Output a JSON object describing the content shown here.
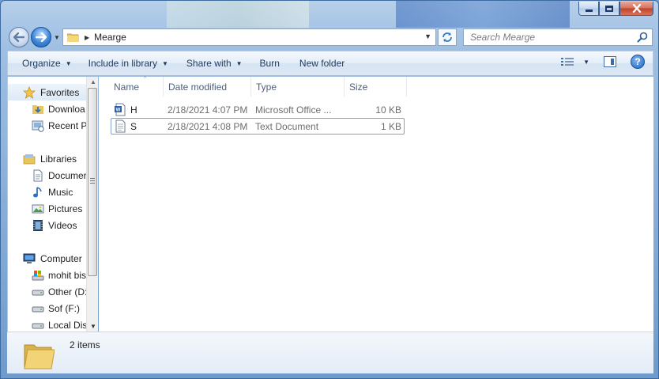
{
  "window": {
    "address": {
      "crumb": "Mearge"
    },
    "search": {
      "placeholder": "Search Mearge"
    }
  },
  "toolbar": {
    "organize": "Organize",
    "include_in_library": "Include in library",
    "share_with": "Share with",
    "burn": "Burn",
    "new_folder": "New folder"
  },
  "navigation": {
    "favorites": "Favorites",
    "downloads": "Downloa",
    "recent_places": "Recent P",
    "libraries": "Libraries",
    "documents": "Documer",
    "music": "Music",
    "pictures": "Pictures",
    "videos": "Videos",
    "computer": "Computer",
    "drive_c": "mohit bis",
    "drive_d": "Other (D:",
    "drive_f": "Sof (F:)",
    "drive_local": "Local Dis"
  },
  "columns": {
    "name": "Name",
    "date_modified": "Date modified",
    "type": "Type",
    "size": "Size"
  },
  "files": [
    {
      "name": "H",
      "date": "2/18/2021 4:07 PM",
      "type": "Microsoft Office ...",
      "size": "10 KB",
      "icon": "word-document-icon"
    },
    {
      "name": "S",
      "date": "2/18/2021 4:08 PM",
      "type": "Text Document",
      "size": "1 KB",
      "icon": "text-document-icon"
    }
  ],
  "status": {
    "item_count": "2 items"
  },
  "colors": {
    "accent": "#1f5fb2",
    "toolbar_text": "#1e395b",
    "selection_border": "#7da2ce"
  }
}
